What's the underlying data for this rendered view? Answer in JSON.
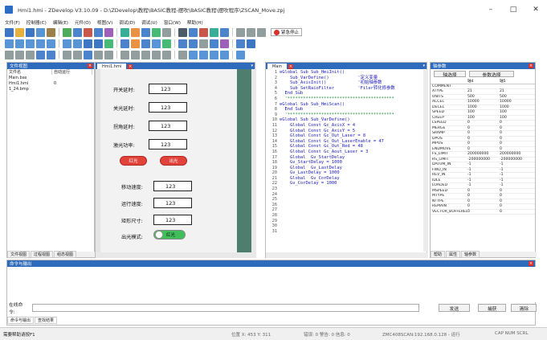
{
  "window": {
    "title": "Hmi1.hmi - ZDevelop V3.10.09 - D:\\ZDevelop\\教程\\BASIC教程-摆吹\\BASIC教程\\摆吹程序\\ZSCAN_Move.zpj",
    "minimize": "–",
    "maximize": "□",
    "close": "✕"
  },
  "menu": [
    "文件(F)",
    "控制器(C)",
    "编辑(E)",
    "元件(O)",
    "视图(V)",
    "调试(D)",
    "调试(U)",
    "窗口(W)",
    "帮助(H)"
  ],
  "toolbar": {
    "row1_colors": [
      "#1b5fb8",
      "#e4a21a",
      "#1b5fb8",
      "#3a82d0",
      "#8a6a2a",
      "#2f9c3d",
      "#2c6fc4",
      "#c0392b",
      "#2c6fc4",
      "#8e44ad",
      "#16a085",
      "#e67e22",
      "#2c6fc4",
      "#27ae60",
      "#7f8c8d",
      "#2c3e50",
      "#2c6fc4",
      "#c0392b",
      "#16a085",
      "#2c6fc4",
      "#7f8c8d",
      "#7f8c8d",
      "#7f8c8d"
    ],
    "emergency_label": "紧急停止",
    "row2_colors": [
      "#3a82d0",
      "#3a82d0",
      "#3a82d0",
      "#3a82d0",
      "#3a82d0",
      "#3a82d0",
      "#3a82d0",
      "#1b5fb8",
      "#1b5fb8",
      "#27ae60",
      "#2c6fc4",
      "#e67e22",
      "#2c6fc4",
      "#3a82d0",
      "#27ae60",
      "#2c6fc4",
      "#2c6fc4",
      "#7f8c8d",
      "#2c6fc4",
      "#8e44ad",
      "#2c6fc4",
      "#1b5fb8"
    ],
    "row3_colors": [
      "#7f8c8d",
      "#7f8c8d",
      "#7f8c8d",
      "#2c6fc4",
      "#2c6fc4",
      "#7f8c8d",
      "#7f8c8d",
      "#2c6fc4",
      "#7f8c8d",
      "#7f8c8d",
      "#7f8c8d",
      "#7f8c8d",
      "#7f8c8d",
      "#7f8c8d",
      "#7f8c8d",
      "#7f8c8d",
      "#3a82d0",
      "#3a82d0",
      "#3a82d0",
      "#3a82d0",
      "#3a82d0"
    ]
  },
  "file_panel": {
    "title": "文件视图",
    "col_name": "文件名",
    "col_auto": "自动运行",
    "files": [
      {
        "name": "Main.bas",
        "auto": ""
      },
      {
        "name": "Hmi1.hmi",
        "auto": "0"
      },
      {
        "name": "1_24.bmp",
        "auto": ""
      }
    ],
    "tabs": [
      "文件视图",
      "过程视图",
      "组态视图"
    ]
  },
  "hmi_editor": {
    "tab": "Hmi1.hmi",
    "fields": [
      {
        "label": "开关延时:",
        "value": "123"
      },
      {
        "label": "关光延时:",
        "value": "123"
      },
      {
        "label": "拐角延时:",
        "value": "123"
      },
      {
        "label": "激光功率:",
        "value": "123"
      }
    ],
    "btn_open": "红光",
    "btn_out": "出光",
    "fields2": [
      {
        "label": "移动速度:",
        "value": "123"
      },
      {
        "label": "运行速度:",
        "value": "123"
      },
      {
        "label": "矩形尺寸:",
        "value": "123"
      }
    ],
    "mode_label": "出光模式:",
    "mode_value": "红光"
  },
  "code_editor": {
    "tab": "Main",
    "lines": [
      "",
      "⊖Global Sub Sub_HmiInit()",
      "    Sub_VarDefine()           '定义变量",
      "    Sub_AxisInit()            '初始轴参数",
      "",
      "    Sub_SetRaioFilter         'Filer转化修参数",
      "  End Sub",
      "",
      "  '*****************************************",
      "⊖Global Sub Sub_HmiScan()",
      "",
      "  End Sub",
      "",
      "",
      "  '*****************************************",
      "⊖Global Sub Sub_VarDefine()",
      "    Global Const Gc_AxisX = 4",
      "    Global Const Gc_AxisY = 5",
      "    Global Const Gc_Out_Laser = 8",
      "    Global Const Gc_Out_LaserEnable = 47",
      "    Global Const Gc_Out_Red = 48",
      "    Global Const Gc_Aout_Laser = 3",
      "",
      "    Global  Gv_StartDelay",
      "    Gv_StartDelay = 1000",
      "",
      "    Global  Gv_LastDelay",
      "    Gv_LastDelay = 1000",
      "",
      "    Global  Gv_CorDelay",
      "    Gv_CorDelay = 1000"
    ]
  },
  "axis_panel": {
    "title": "轴参数",
    "btn_axis": "轴选择",
    "btn_param": "参数选择",
    "col_axis4": "轴4",
    "col_axis5": "轴5",
    "rows": [
      {
        "name": "COMMENT",
        "a": "",
        "b": ""
      },
      {
        "name": "ATYPE",
        "a": "21",
        "b": "21"
      },
      {
        "name": "UNITS",
        "a": "500",
        "b": "500"
      },
      {
        "name": "ACCEL",
        "a": "10000",
        "b": "10000"
      },
      {
        "name": "DECEL",
        "a": "1000",
        "b": "1000"
      },
      {
        "name": "SPEED",
        "a": "100",
        "b": "100"
      },
      {
        "name": "CREEP",
        "a": "100",
        "b": "100"
      },
      {
        "name": "LSPEED",
        "a": "0",
        "b": "0"
      },
      {
        "name": "MERGE",
        "a": "0",
        "b": "0"
      },
      {
        "name": "SRAMP",
        "a": "0",
        "b": "0"
      },
      {
        "name": "DPOS",
        "a": "0",
        "b": "0"
      },
      {
        "name": "MPOS",
        "a": "0",
        "b": "0"
      },
      {
        "name": "ENDMOVE",
        "a": "0",
        "b": "0"
      },
      {
        "name": "FS_LIMIT",
        "a": "200000000",
        "b": "200000000"
      },
      {
        "name": "RS_LIMIT",
        "a": "-200000000",
        "b": "-200000000"
      },
      {
        "name": "DATUM_IN",
        "a": "-1",
        "b": "-1"
      },
      {
        "name": "FWD_IN",
        "a": "-1",
        "b": "-1"
      },
      {
        "name": "REV_IN",
        "a": "-1",
        "b": "-1"
      },
      {
        "name": "IDLE",
        "a": "-1",
        "b": "-1"
      },
      {
        "name": "LOADED",
        "a": "-1",
        "b": "-1"
      },
      {
        "name": "MSPEED",
        "a": "0",
        "b": "0"
      },
      {
        "name": "MTYPE",
        "a": "0",
        "b": "0"
      },
      {
        "name": "NTYPE",
        "a": "0",
        "b": "0"
      },
      {
        "name": "REMAIN",
        "a": "0",
        "b": "0"
      },
      {
        "name": "VECTOR_BUFFERED",
        "a": "0",
        "b": "0"
      }
    ],
    "tabs": [
      "帮助",
      "属性",
      "轴参数"
    ]
  },
  "output_panel": {
    "title": "命令与输出",
    "cmd_label": "在线命令:",
    "btn_send": "发送",
    "btn_capture": "捕获",
    "btn_clear": "清除",
    "tabs": [
      "命令与输出",
      "查找结果"
    ]
  },
  "status": {
    "help": "需要帮助请按F1",
    "position": "位置 X: 453 Y: 311",
    "errors": "错误: 0  警告: 0  信息: 0",
    "controller": "ZMC408SCAN:192.168.0.128 - 运行",
    "indicators": "CAP  NUM  SCRL"
  }
}
